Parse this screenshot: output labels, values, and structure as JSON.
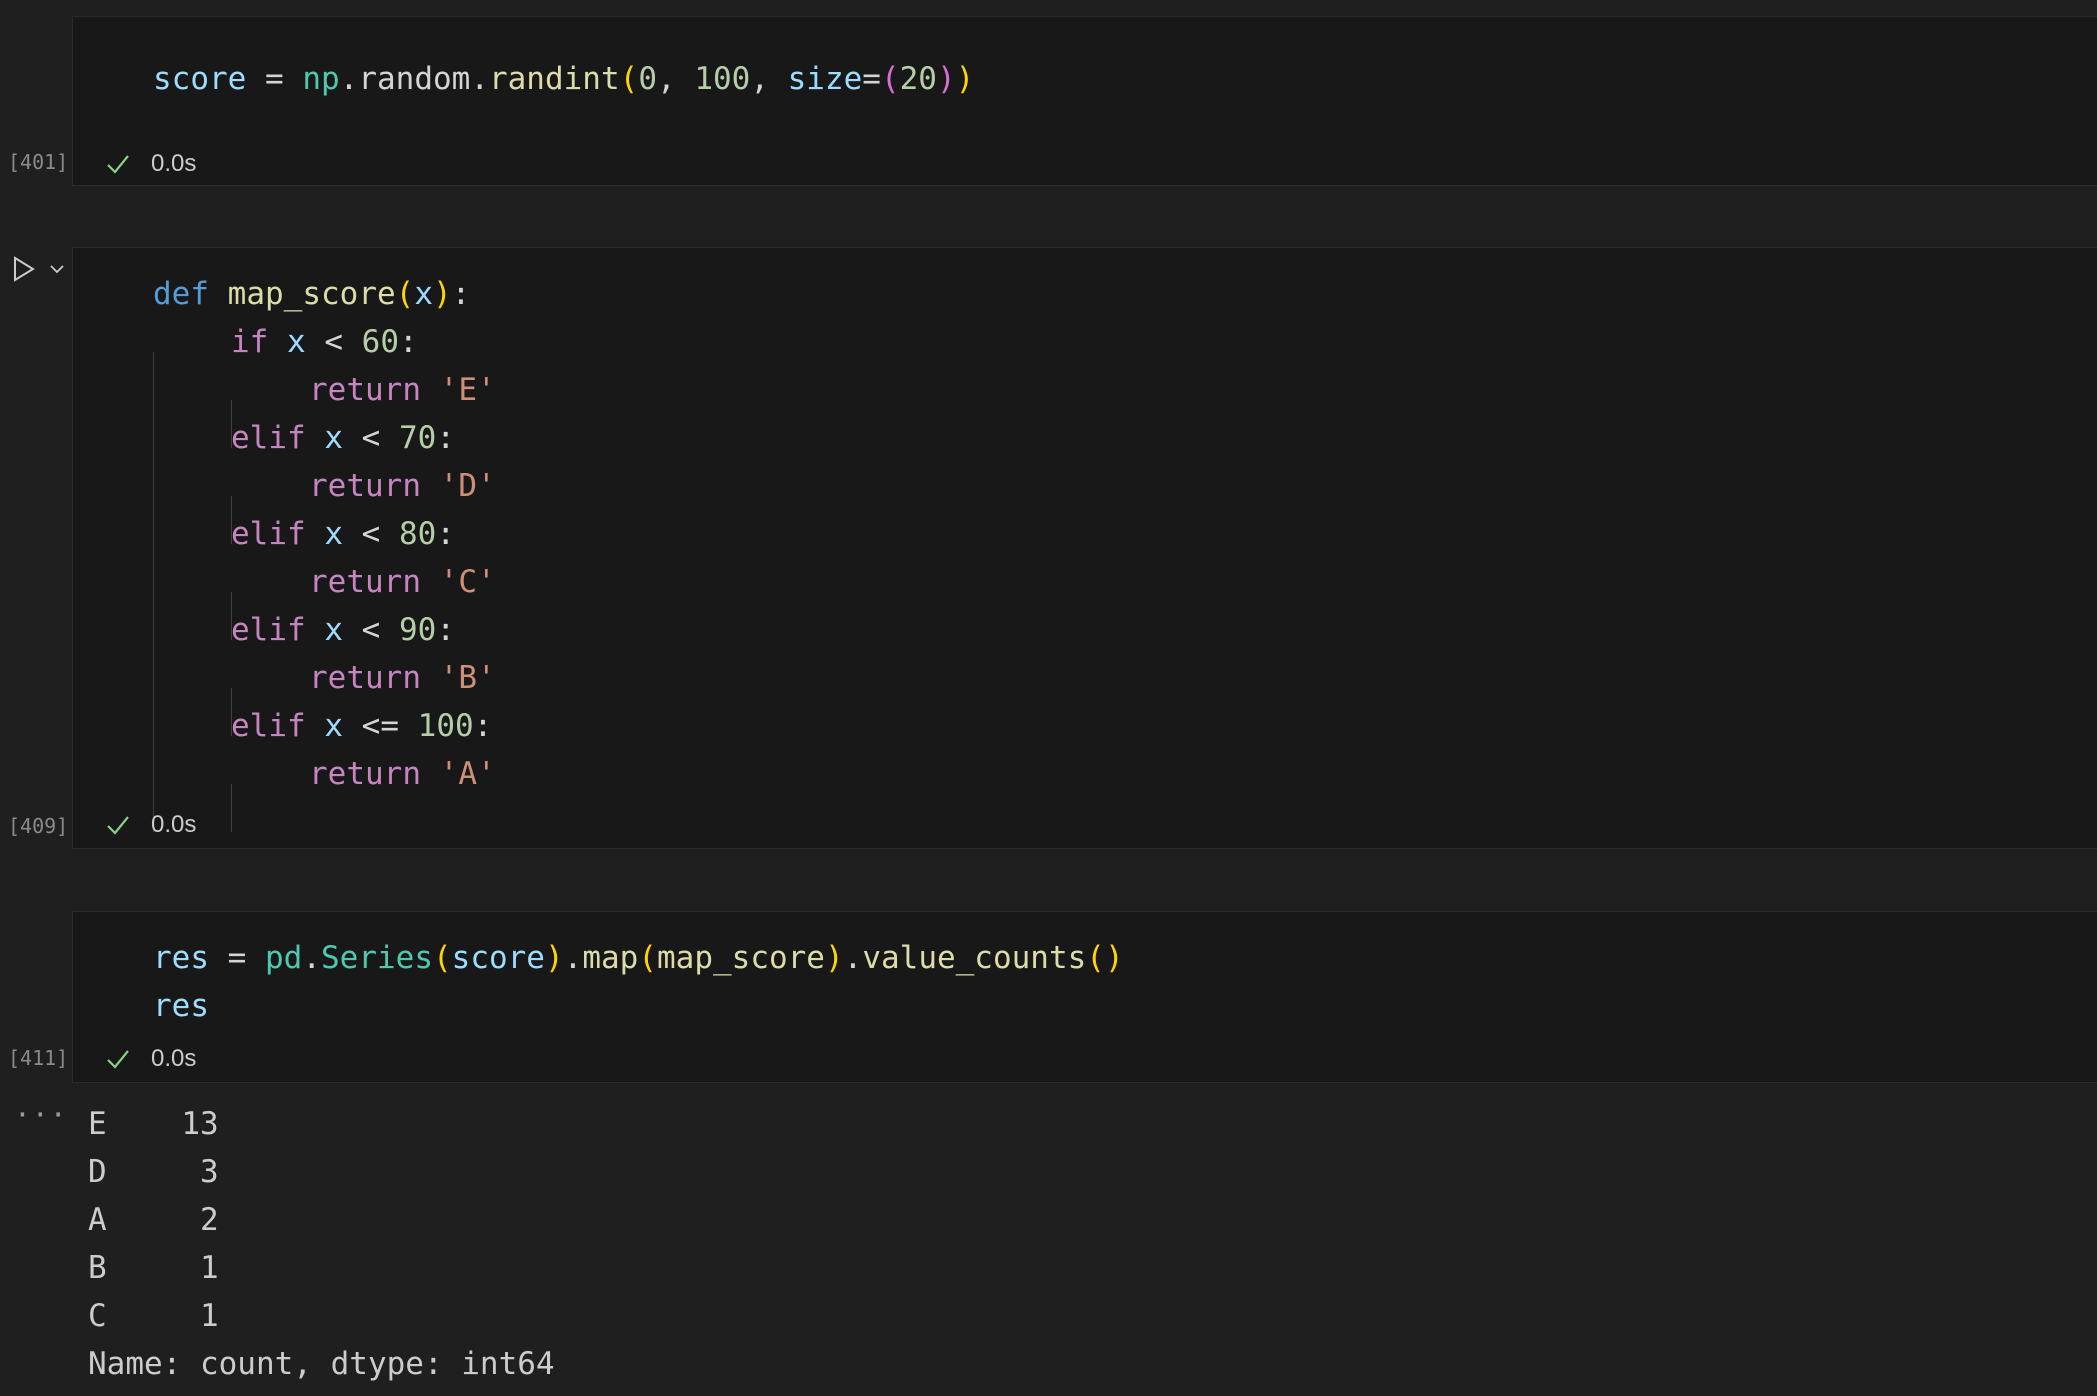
{
  "cells": [
    {
      "exec_count": "[401]",
      "status_time": "0.0s",
      "line1": {
        "t0": "score",
        "t1": " = ",
        "t2": "np",
        "t3": ".",
        "t4": "random",
        "t5": ".",
        "t6": "randint",
        "t7": "(",
        "t8": "0",
        "t9": ", ",
        "t10": "100",
        "t11": ", ",
        "t12": "size",
        "t13": "=",
        "t14": "(",
        "t15": "20",
        "t16": ")",
        "t17": ")"
      }
    },
    {
      "exec_count": "[409]",
      "status_time": "0.0s",
      "def_kw": "def",
      "fn_name": "map_score",
      "param": "x",
      "lines": [
        {
          "kw": "if",
          "var": "x",
          "op": " < ",
          "num": "60",
          "colon": ":"
        },
        {
          "ret": "return",
          "str": "'E'"
        },
        {
          "kw": "elif",
          "var": "x",
          "op": " < ",
          "num": "70",
          "colon": ":"
        },
        {
          "ret": "return",
          "str": "'D'"
        },
        {
          "kw": "elif",
          "var": "x",
          "op": " < ",
          "num": "80",
          "colon": ":"
        },
        {
          "ret": "return",
          "str": "'C'"
        },
        {
          "kw": "elif",
          "var": "x",
          "op": " < ",
          "num": "90",
          "colon": ":"
        },
        {
          "ret": "return",
          "str": "'B'"
        },
        {
          "kw": "elif",
          "var": "x",
          "op": " <= ",
          "num": "100",
          "colon": ":"
        },
        {
          "ret": "return",
          "str": "'A'"
        }
      ]
    },
    {
      "exec_count": "[411]",
      "status_time": "0.0s",
      "line1": {
        "a": "res",
        "b": " = ",
        "c": "pd",
        "d": ".",
        "e": "Series",
        "f": "(",
        "g": "score",
        "h": ")",
        "i": ".",
        "j": "map",
        "k": "(",
        "l": "map_score",
        "m": ")",
        "n": ".",
        "o": "value_counts",
        "p": "()"
      },
      "line2": "res"
    }
  ],
  "output": {
    "ellipsis": "···",
    "rows": [
      "E    13",
      "D     3",
      "A     2",
      "B     1",
      "C     1"
    ],
    "footer": "Name: count, dtype: int64"
  },
  "colors": {
    "background": "#1f1f1f",
    "cell_background": "#181818",
    "check_green": "#89d185"
  },
  "icons": [
    "run-icon",
    "chevron-down-icon",
    "check-icon",
    "ellipsis-icon"
  ]
}
